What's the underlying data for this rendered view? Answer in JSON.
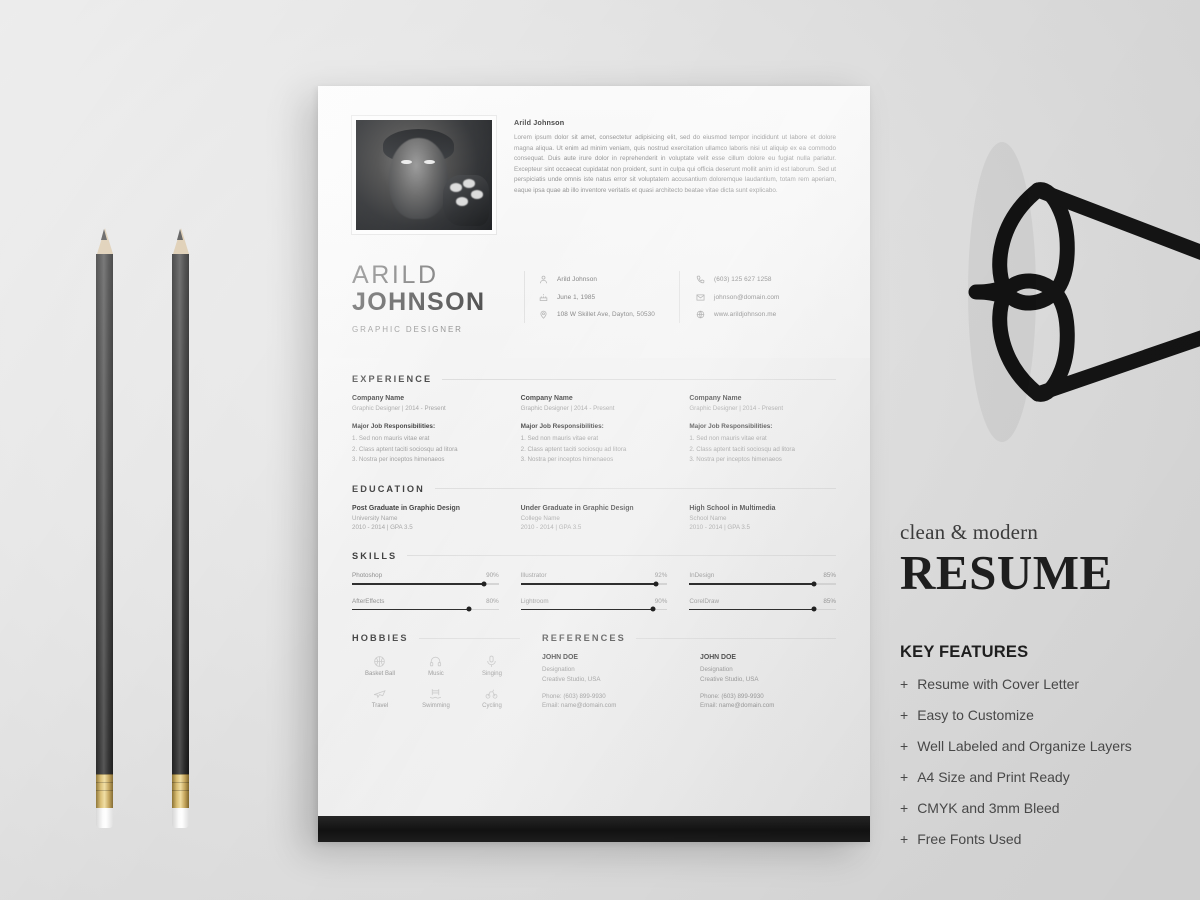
{
  "resume": {
    "bio": {
      "name": "Arild Johnson",
      "text": "Lorem ipsum dolor sit amet, consectetur adipisicing elit, sed do eiusmod tempor incididunt ut labore et dolore magna aliqua. Ut enim ad minim veniam, quis nostrud exercitation ullamco laboris nisi ut aliquip ex ea commodo consequat. Duis aute irure dolor in reprehenderit in voluptate velit esse cillum dolore eu fugiat nulla pariatur. Excepteur sint occaecat cupidatat non proident, sunt in culpa qui officia deserunt mollit anim id est laborum. Sed ut perspiciatis unde omnis iste natus error sit voluptatem accusantium doloremque laudantium, totam rem aperiam, eaque ipsa quae ab illo inventore veritatis et quasi architecto beatae vitae dicta sunt explicabo."
    },
    "name": {
      "first": "ARILD",
      "last": "JOHNSON",
      "role": "GRAPHIC DESIGNER"
    },
    "contact": {
      "left": [
        {
          "icon": "person-icon",
          "value": "Arild Johnson"
        },
        {
          "icon": "birthday-icon",
          "value": "June 1, 1985"
        },
        {
          "icon": "location-pin-icon",
          "value": "108 W Skillet Ave, Dayton, 50530"
        }
      ],
      "right": [
        {
          "icon": "phone-icon",
          "value": "(603) 125 627 1258"
        },
        {
          "icon": "envelope-icon",
          "value": "johnson@domain.com"
        },
        {
          "icon": "globe-icon",
          "value": "www.arildjohnson.me"
        }
      ]
    },
    "sections": {
      "experience": "EXPERIENCE",
      "education": "EDUCATION",
      "skills": "SKILLS",
      "hobbies": "HOBBIES",
      "references": "REFERENCES"
    },
    "experience": [
      {
        "company": "Company Name",
        "meta": "Graphic Designer  |  2014 - Present",
        "resp_label": "Major Job Responsibilities:",
        "items": [
          "1. Sed non  mauris vitae erat",
          "2. Class aptent taciti sociosqu ad litora",
          "3. Nostra per inceptos himenaeos"
        ]
      },
      {
        "company": "Company Name",
        "meta": "Graphic Designer  |  2014 - Present",
        "resp_label": "Major Job Responsibilities:",
        "items": [
          "1. Sed non  mauris vitae erat",
          "2. Class aptent taciti sociosqu ad litora",
          "3. Nostra per inceptos himenaeos"
        ]
      },
      {
        "company": "Company Name",
        "meta": "Graphic Designer  |  2014 - Present",
        "resp_label": "Major Job Responsibilities:",
        "items": [
          "1. Sed non  mauris vitae erat",
          "2. Class aptent taciti sociosqu ad litora",
          "3. Nostra per inceptos himenaeos"
        ]
      }
    ],
    "education": [
      {
        "degree": "Post Graduate in Graphic Design",
        "org": "University Name",
        "years": "2010 - 2014  |  GPA 3.5"
      },
      {
        "degree": "Under Graduate in Graphic Design",
        "org": "College Name",
        "years": "2010 - 2014  |  GPA 3.5"
      },
      {
        "degree": "High School in Multimedia",
        "org": "School Name",
        "years": "2010 - 2014  |  GPA 3.5"
      }
    ],
    "skills": [
      [
        {
          "name": "Photoshop",
          "pct": "90%",
          "value": 90
        },
        {
          "name": "AfterEffects",
          "pct": "80%",
          "value": 80
        }
      ],
      [
        {
          "name": "Illustrator",
          "pct": "92%",
          "value": 92
        },
        {
          "name": "Lightroom",
          "pct": "90%",
          "value": 90
        }
      ],
      [
        {
          "name": "InDesign",
          "pct": "85%",
          "value": 85
        },
        {
          "name": "CorelDraw",
          "pct": "85%",
          "value": 85
        }
      ]
    ],
    "hobbies": [
      {
        "icon": "basketball-icon",
        "label": "Basket Ball"
      },
      {
        "icon": "headphones-icon",
        "label": "Music"
      },
      {
        "icon": "microphone-icon",
        "label": "Singing"
      },
      {
        "icon": "travel-icon",
        "label": "Travel"
      },
      {
        "icon": "swimming-icon",
        "label": "Swimming"
      },
      {
        "icon": "bicycle-icon",
        "label": "Cycling"
      }
    ],
    "references": [
      {
        "name": "JOHN DOE",
        "designation": "Designation",
        "studio": "Creative Studio, USA",
        "phone": "Phone: (603) 899-9930",
        "email": "Email: name@domain.com"
      },
      {
        "name": "JOHN DOE",
        "designation": "Designation",
        "studio": "Creative Studio, USA",
        "phone": "Phone: (603) 899-9930",
        "email": "Email: name@domain.com"
      }
    ]
  },
  "promo": {
    "kicker": "clean & modern",
    "title": "RESUME",
    "features_heading": "KEY FEATURES",
    "plus": "+",
    "features": [
      "Resume with Cover Letter",
      "Easy to Customize",
      "Well Labeled and Organize Layers",
      "A4 Size and Print Ready",
      "CMYK and 3mm Bleed",
      "Free Fonts Used"
    ]
  },
  "colors": {
    "page": "#f3f3f3",
    "backdrop": "#e2e2e2",
    "ink": "#1f1f1f",
    "muted": "#8d8d8d",
    "footer_bar": "#141414"
  }
}
